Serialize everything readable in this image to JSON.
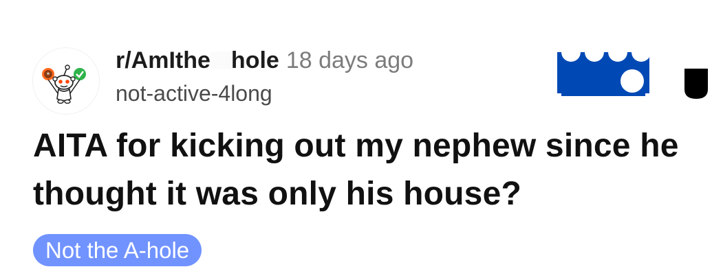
{
  "post": {
    "subreddit_prefix": "r/AmIthe",
    "subreddit_suffix": "hole",
    "time_ago": "18 days ago",
    "author": "not-active-4long",
    "title": "AITA for kicking out my nephew since he thought it was only his house?",
    "flair": "Not the A-hole"
  },
  "icons": {
    "avatar": "snoo-avatar-icon",
    "join": "join-button-icon",
    "more": "more-options-icon"
  },
  "colors": {
    "flair_bg": "#7193ff",
    "join_blue": "#0049b5",
    "subreddit_text": "#1c1c1c",
    "time_text": "#7c7c7c"
  }
}
